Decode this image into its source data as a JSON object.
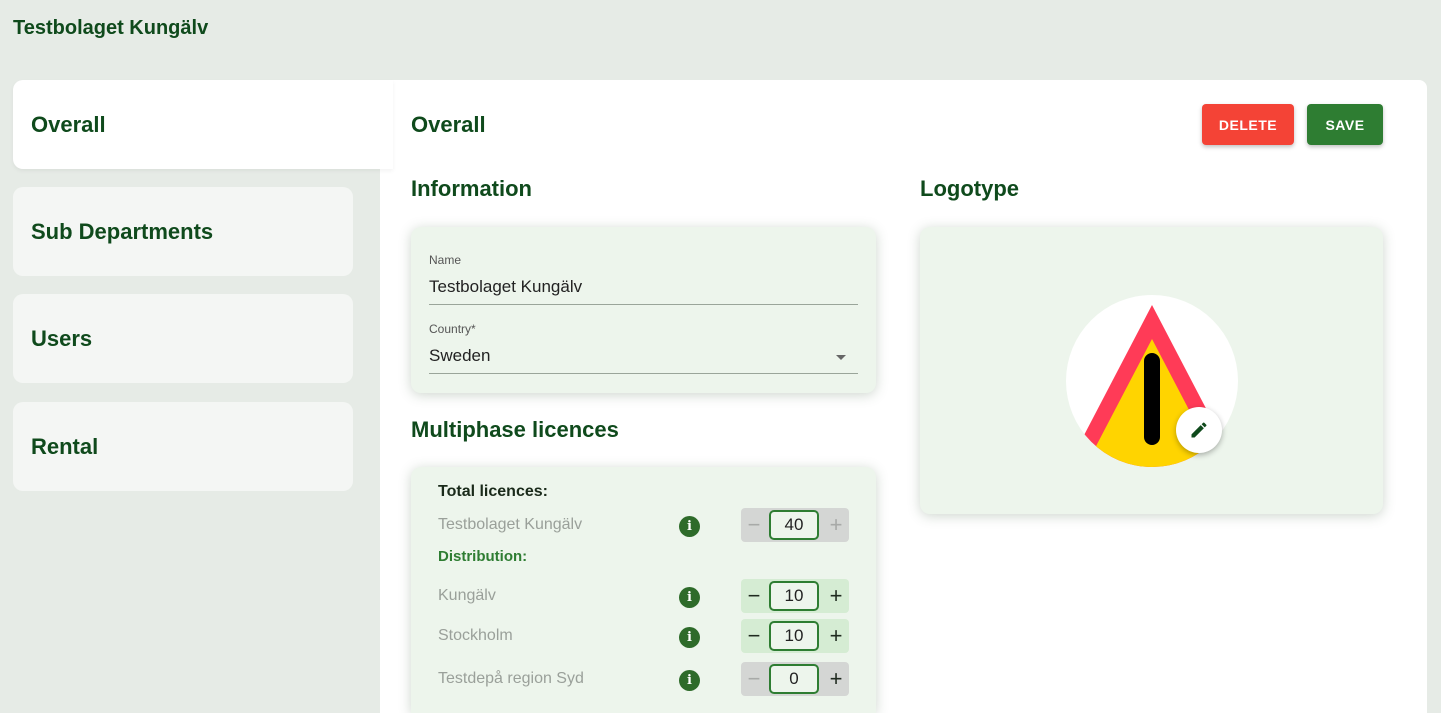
{
  "header": {
    "title": "Testbolaget Kungälv"
  },
  "sidebar": {
    "items": [
      {
        "label": "Overall",
        "active": true
      },
      {
        "label": "Sub Departments",
        "active": false
      },
      {
        "label": "Users",
        "active": false
      },
      {
        "label": "Rental",
        "active": false
      }
    ]
  },
  "main": {
    "title": "Overall",
    "delete_label": "DELETE",
    "save_label": "SAVE",
    "information": {
      "title": "Information",
      "name_label": "Name",
      "name_value": "Testbolaget Kungälv",
      "country_label": "Country*",
      "country_value": "Sweden"
    },
    "logotype": {
      "title": "Logotype",
      "icon": "warning-triangle-icon",
      "edit_icon": "pencil-icon"
    },
    "licences": {
      "title": "Multiphase licences",
      "total_label": "Total licences:",
      "distribution_label": "Distribution:",
      "total_row": {
        "name": "Testbolaget Kungälv",
        "value": "40"
      },
      "rows": [
        {
          "name": "Kungälv",
          "value": "10"
        },
        {
          "name": "Stockholm",
          "value": "10"
        },
        {
          "name": "Testdepå region Syd",
          "value": "0"
        }
      ],
      "minus_symbol": "−",
      "plus_symbol": "+",
      "info_symbol": "i"
    }
  },
  "colors": {
    "brand_green": "#2e7d32",
    "dark_green": "#0f4a1c",
    "delete_red": "#f44336",
    "card_bg": "#edf5ec"
  }
}
